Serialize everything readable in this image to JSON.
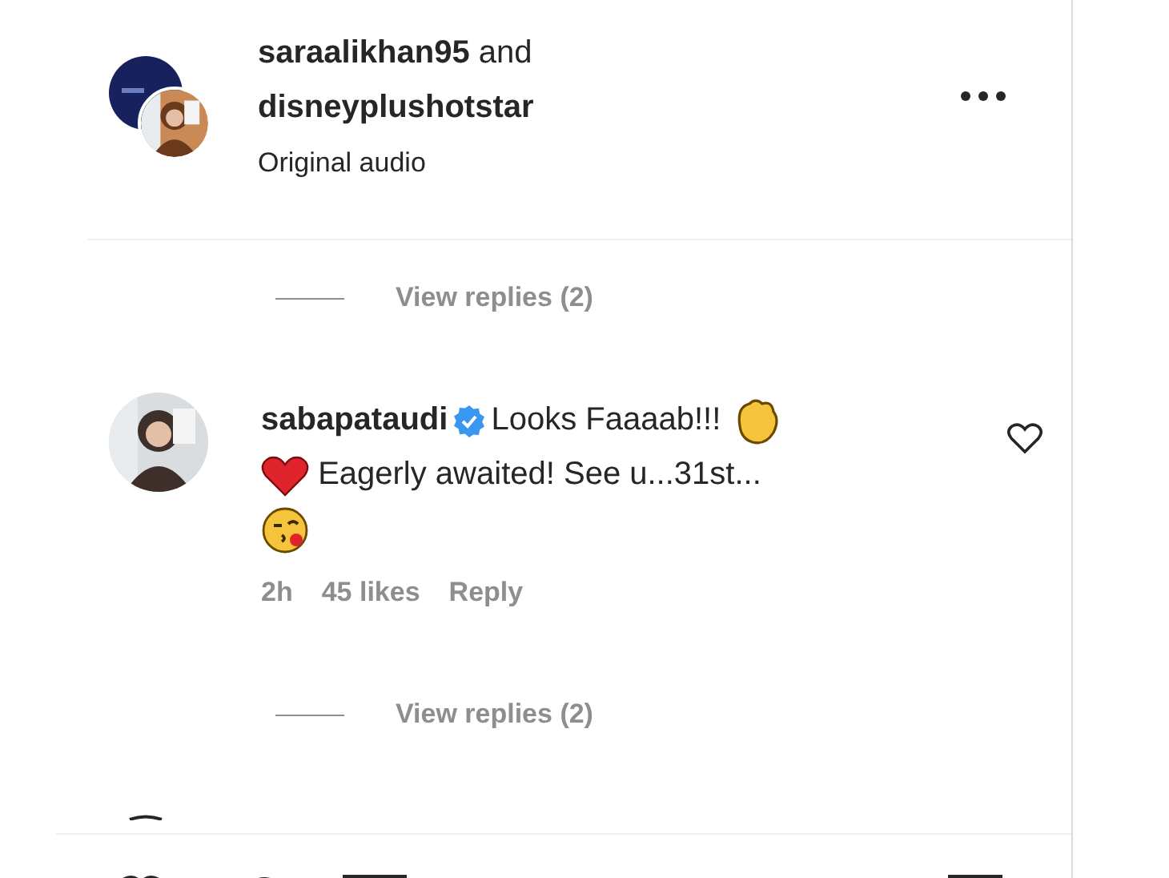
{
  "post_header": {
    "usernames": [
      "saraalikhan95",
      "disneyplushotstar"
    ],
    "joiner": "and",
    "subtitle": "Original audio"
  },
  "comments": [
    {
      "kind": "replies_toggle",
      "label": "View replies (2)"
    },
    {
      "kind": "comment",
      "username": "sabapataudi",
      "verified": true,
      "liked": false,
      "parts": [
        {
          "kind": "text",
          "text": "Looks Faaaab!!!"
        },
        {
          "kind": "clap"
        },
        {
          "kind": "heart"
        },
        {
          "kind": "text",
          "text": "Eagerly awaited! See u...31st..."
        },
        {
          "kind": "kiss"
        }
      ],
      "time": "2h",
      "likes": "45 likes",
      "reply": "Reply"
    },
    {
      "kind": "replies_toggle",
      "label": "View replies (2)"
    }
  ]
}
